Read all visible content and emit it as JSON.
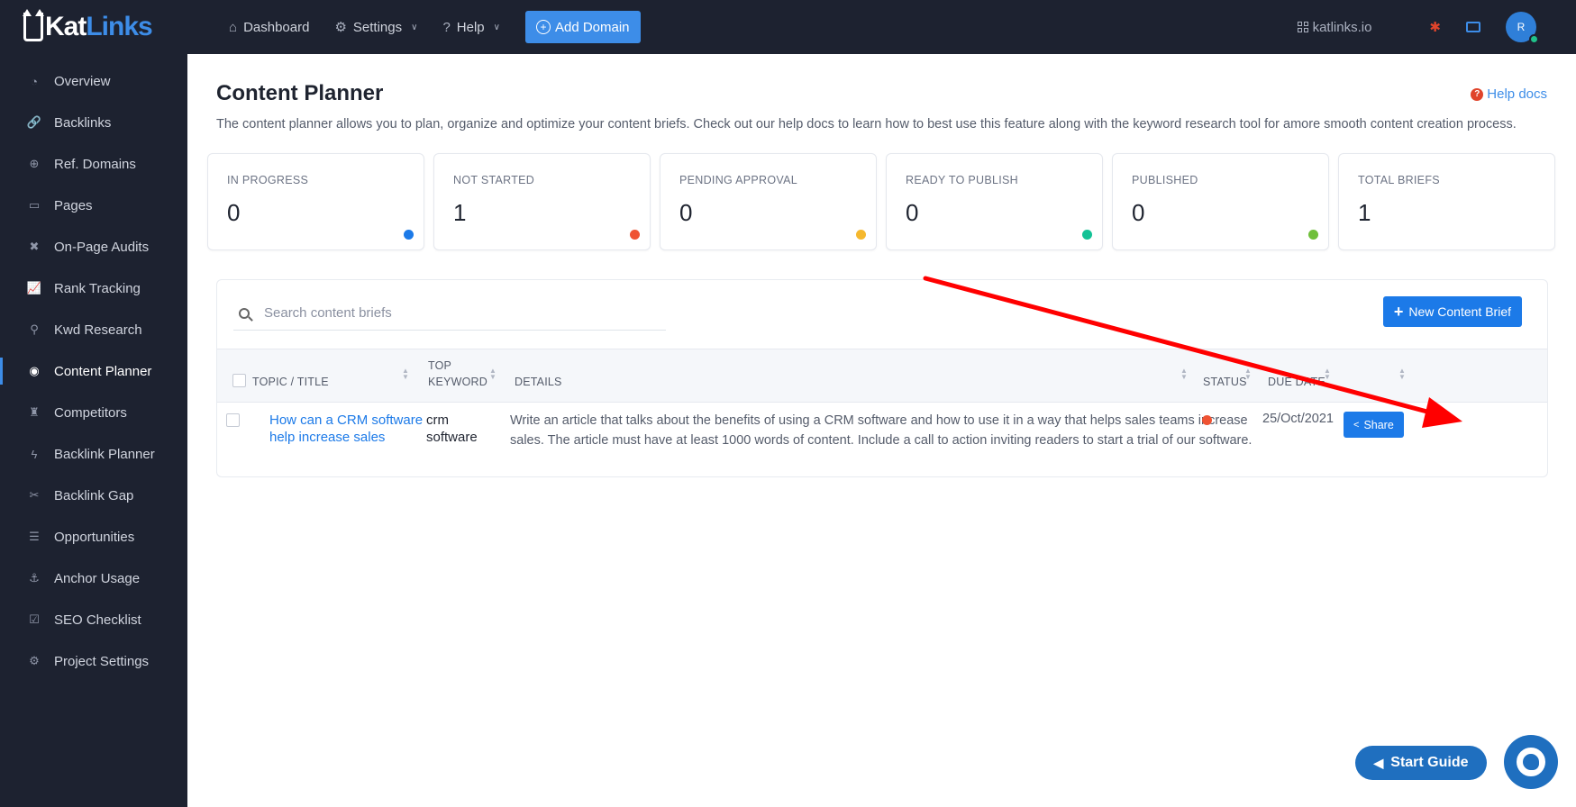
{
  "brand": {
    "part1": "Kat",
    "part2": "Links"
  },
  "sidebar": {
    "items": [
      {
        "label": "Overview",
        "icon": "gauge-icon",
        "glyph": "◔"
      },
      {
        "label": "Backlinks",
        "icon": "link-icon",
        "glyph": "🔗"
      },
      {
        "label": "Ref. Domains",
        "icon": "globe-icon",
        "glyph": "⊕"
      },
      {
        "label": "Pages",
        "icon": "window-icon",
        "glyph": "▭"
      },
      {
        "label": "On-Page Audits",
        "icon": "tools-icon",
        "glyph": "✖"
      },
      {
        "label": "Rank Tracking",
        "icon": "line-chart-icon",
        "glyph": "📈"
      },
      {
        "label": "Kwd Research",
        "icon": "search-icon",
        "glyph": "⚲"
      },
      {
        "label": "Content Planner",
        "icon": "fingerprint-icon",
        "glyph": "◉"
      },
      {
        "label": "Competitors",
        "icon": "chess-icon",
        "glyph": "♜"
      },
      {
        "label": "Backlink Planner",
        "icon": "bolt-icon",
        "glyph": "ϟ"
      },
      {
        "label": "Backlink Gap",
        "icon": "unlink-icon",
        "glyph": "✂"
      },
      {
        "label": "Opportunities",
        "icon": "list-icon",
        "glyph": "☰"
      },
      {
        "label": "Anchor Usage",
        "icon": "anchor-icon",
        "glyph": "⚓"
      },
      {
        "label": "SEO Checklist",
        "icon": "checkbox-icon",
        "glyph": "☑"
      },
      {
        "label": "Project Settings",
        "icon": "gear-icon",
        "glyph": "⚙"
      }
    ],
    "active_index": 7
  },
  "topbar": {
    "dashboard": "Dashboard",
    "settings": "Settings",
    "help": "Help",
    "add_domain": "Add Domain",
    "site": "katlinks.io",
    "avatar_initial": "R"
  },
  "page": {
    "title": "Content Planner",
    "help_docs": "Help docs",
    "description": "The content planner allows you to plan, organize and optimize your content briefs. Check out our help docs to learn how to best use this feature along with the keyword research tool for amore smooth content creation process."
  },
  "stats": [
    {
      "label": "IN PROGRESS",
      "value": "0",
      "color": "#1c7ae8"
    },
    {
      "label": "NOT STARTED",
      "value": "1",
      "color": "#ef5333"
    },
    {
      "label": "PENDING APPROVAL",
      "value": "0",
      "color": "#f5b82e"
    },
    {
      "label": "READY TO PUBLISH",
      "value": "0",
      "color": "#13c296"
    },
    {
      "label": "PUBLISHED",
      "value": "0",
      "color": "#6fbf3a"
    },
    {
      "label": "TOTAL BRIEFS",
      "value": "1",
      "color": null
    }
  ],
  "table": {
    "search_placeholder": "Search content briefs",
    "new_brief": "New Content Brief",
    "columns": {
      "topic": "TOPIC / TITLE",
      "keyword_line1": "TOP",
      "keyword_line2": "KEYWORD",
      "details": "DETAILS",
      "status": "STATUS",
      "due": "DUE DATE"
    },
    "rows": [
      {
        "topic": "How can a CRM software help increase sales",
        "keyword": "crm software",
        "details": "Write an article that talks about the benefits of using a CRM software and how to use it in a way that helps sales teams increase sales. The article must have at least 1000 words of content. Include a call to action inviting readers to start a trial of our software.",
        "status_color": "#ef5333",
        "due": "25/Oct/2021",
        "share": "Share"
      }
    ]
  },
  "footer": {
    "start_guide": "Start Guide"
  },
  "colors": {
    "sidebar_bg": "#1d2230",
    "accent": "#3d8de8",
    "primary_button": "#1c7ae8",
    "annotation_arrow": "#ff0000"
  }
}
